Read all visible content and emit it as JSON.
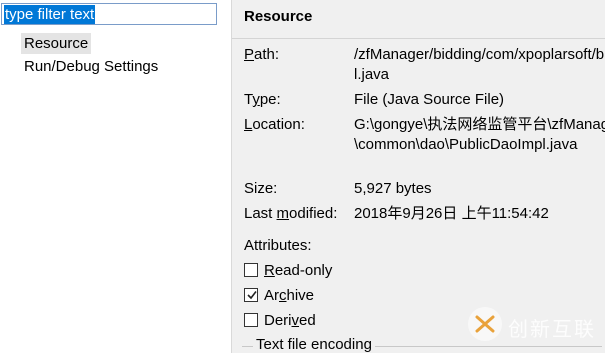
{
  "filter": {
    "value": "type filter text"
  },
  "tree": {
    "items": [
      {
        "label": "Resource"
      },
      {
        "label": "Run/Debug Settings"
      }
    ]
  },
  "resource": {
    "title": "Resource",
    "path_label": "Path:",
    "path_value_line1": "/zfManager/bidding/com/xpoplarsoft/bidding/common/dao/PublicDaoImp",
    "path_value_line2": "l.java",
    "type_label": "Type:",
    "type_value": "File  (Java Source File)",
    "location_label": "Location:",
    "location_value_line1": "G:\\gongye\\执法网络监管平台\\zfManager\\bidding\\com\\xpoplarsoft\\bidding",
    "location_value_line2": "\\common\\dao\\PublicDaoImpl.java",
    "size_label": "Size:",
    "size_value": "5,927  bytes",
    "modified_label": "Last modified:",
    "modified_value": "2018年9月26日 上午11:54:42",
    "attributes_label": "Attributes:",
    "attributes": [
      {
        "label": "Read-only",
        "checked": false
      },
      {
        "label": "Archive",
        "checked": true
      },
      {
        "label": "Derived",
        "checked": false
      }
    ],
    "encoding_group": "Text file encoding"
  },
  "watermark": {
    "text": "创新互联"
  }
}
